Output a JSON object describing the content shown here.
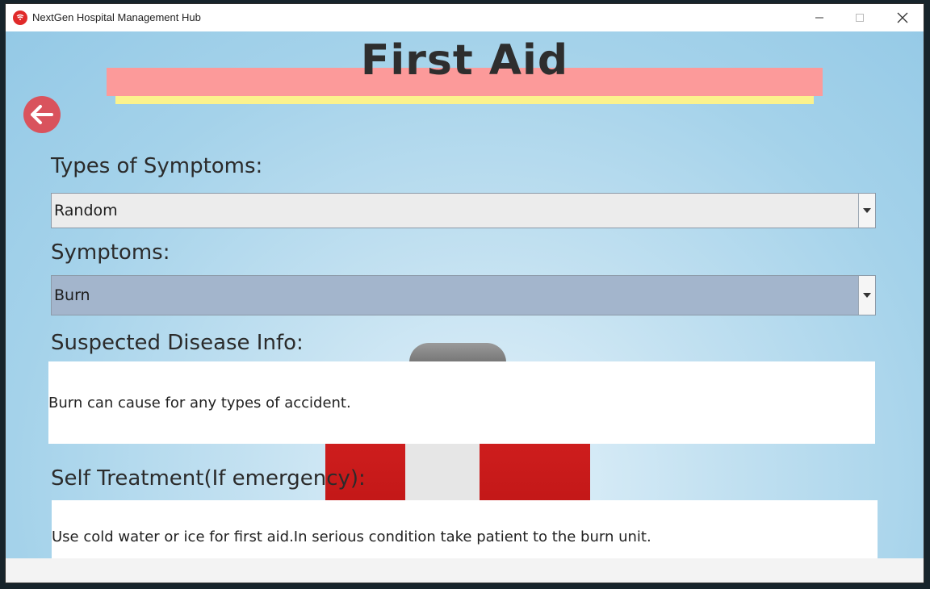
{
  "window": {
    "title": "NextGen Hospital Management Hub",
    "minimize": "—",
    "maximize": "☐",
    "close": "✕"
  },
  "page": {
    "title": "First Aid",
    "back_icon": "arrow-left-icon"
  },
  "symptom_type": {
    "label": "Types of Symptoms:",
    "selected": "Random",
    "background": "#ececec"
  },
  "symptom": {
    "label": "Symptoms:",
    "selected": "Burn",
    "background": "#a3b5cc"
  },
  "disease_info": {
    "label": "Suspected Disease Info:",
    "text": "Burn can cause for any types of accident."
  },
  "self_treatment": {
    "label": "Self Treatment(If emergency):",
    "text": "Use cold water or ice for first aid.In serious condition take patient to the burn unit."
  },
  "colors": {
    "banner_pink": "#fc9a9a",
    "banner_yellow": "#fbf28d",
    "back_button": "#d9535d"
  }
}
